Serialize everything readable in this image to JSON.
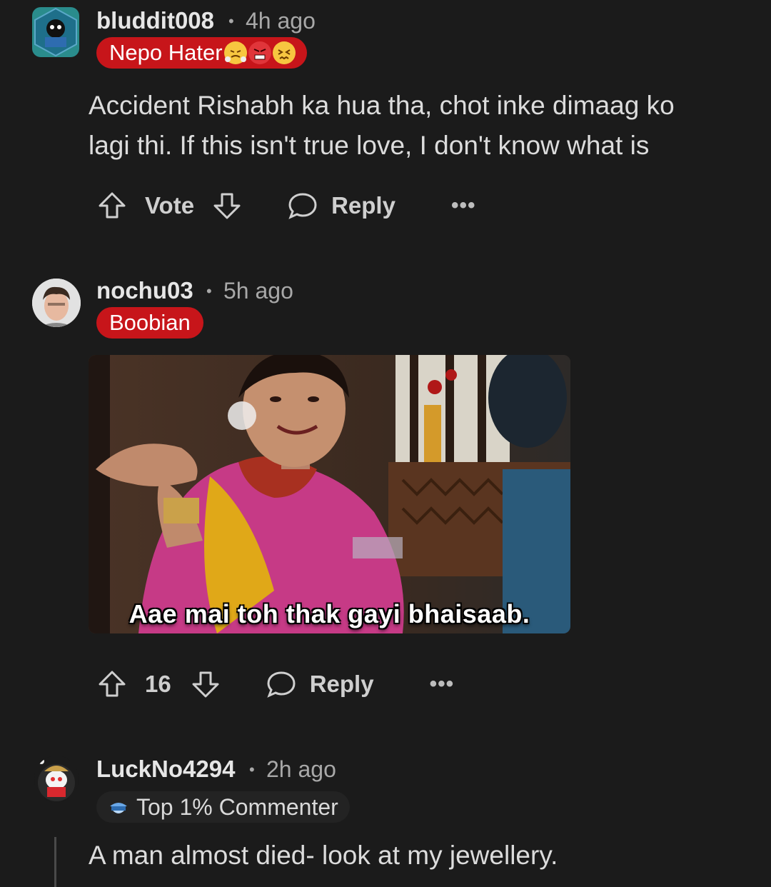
{
  "comments": [
    {
      "username": "bluddit008",
      "separator": "•",
      "time": "4h ago",
      "flair": "Nepo Hater",
      "flair_emojis": [
        "steam-face-emoji",
        "angry-face-emoji",
        "confounded-face-emoji"
      ],
      "body_lines": [
        "Accident Rishabh ka hua tha, chot inke dimaag ko",
        "lagi thi. If this isn't true love, I don't know what is"
      ],
      "vote_label": "Vote",
      "reply_label": "Reply",
      "more_label": "•••"
    },
    {
      "username": "nochu03",
      "separator": "•",
      "time": "5h ago",
      "flair": "Boobian",
      "meme_caption": "Aae mai toh thak gayi bhaisaab.",
      "vote_label": "16",
      "reply_label": "Reply",
      "more_label": "•••"
    },
    {
      "username": "LuckNo4294",
      "separator": "•",
      "time": "2h ago",
      "badge": "Top 1% Commenter",
      "body_lines": [
        "A man almost died- look at my jewellery."
      ]
    }
  ],
  "colors": {
    "background": "#1b1b1b",
    "flair_red": "#c7151a",
    "text": "#dcdcdc",
    "muted": "#a8a8a8"
  }
}
